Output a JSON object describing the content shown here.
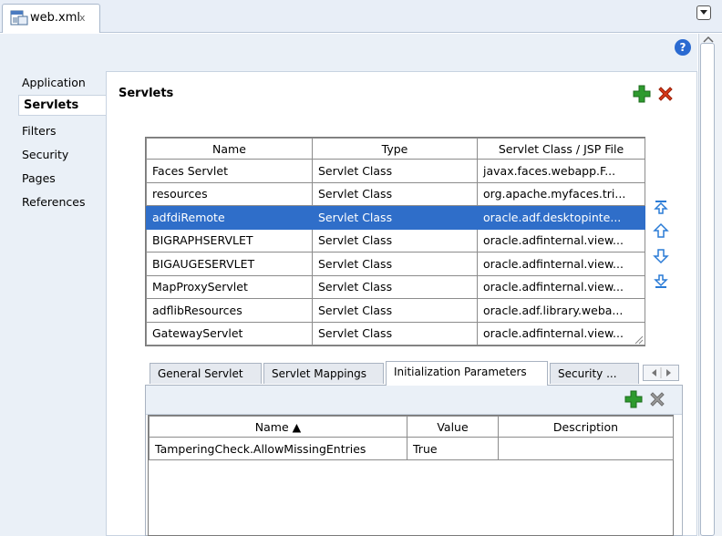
{
  "editor_tab": {
    "label": "web.xml",
    "close": "x"
  },
  "help": {
    "label": "?"
  },
  "nav": {
    "items": [
      {
        "label": "Application"
      },
      {
        "label": "Servlets"
      },
      {
        "label": "Filters"
      },
      {
        "label": "Security"
      },
      {
        "label": "Pages"
      },
      {
        "label": "References"
      }
    ],
    "active": "Servlets"
  },
  "section": {
    "title": "Servlets"
  },
  "servlet_table": {
    "columns": [
      "Name",
      "Type",
      "Servlet Class / JSP File"
    ],
    "rows": [
      {
        "name": "Faces Servlet",
        "type": "Servlet Class",
        "cls": "javax.faces.webapp.F..."
      },
      {
        "name": "resources",
        "type": "Servlet Class",
        "cls": "org.apache.myfaces.tri..."
      },
      {
        "name": "adfdiRemote",
        "type": "Servlet Class",
        "cls": "oracle.adf.desktopinte..."
      },
      {
        "name": "BIGRAPHSERVLET",
        "type": "Servlet Class",
        "cls": "oracle.adfinternal.view..."
      },
      {
        "name": "BIGAUGESERVLET",
        "type": "Servlet Class",
        "cls": "oracle.adfinternal.view..."
      },
      {
        "name": "MapProxyServlet",
        "type": "Servlet Class",
        "cls": "oracle.adfinternal.view..."
      },
      {
        "name": "adflibResources",
        "type": "Servlet Class",
        "cls": "oracle.adf.library.weba..."
      },
      {
        "name": "GatewayServlet",
        "type": "Servlet Class",
        "cls": "oracle.adfinternal.view..."
      }
    ],
    "selected_row": "adfdiRemote"
  },
  "sub_tabs": {
    "items": [
      "General Servlet",
      "Servlet Mappings",
      "Initialization Parameters",
      "Security ..."
    ],
    "active": "Initialization Parameters"
  },
  "params_table": {
    "columns": [
      "Name ▲",
      "Value",
      "Description"
    ],
    "rows": [
      {
        "name": "TamperingCheck.AllowMissingEntries",
        "value": "True",
        "description": ""
      }
    ]
  },
  "colors": {
    "selection": "#2f6ec9",
    "add_green": "#2e9a2e",
    "delete_red": "#d93a1a",
    "arrow_blue": "#2a7bd6"
  },
  "icons": [
    "web-xml-file-icon",
    "dropdown-icon",
    "help-icon",
    "add-icon",
    "delete-icon",
    "move-top-icon",
    "move-up-icon",
    "move-down-icon",
    "move-bottom-icon"
  ]
}
